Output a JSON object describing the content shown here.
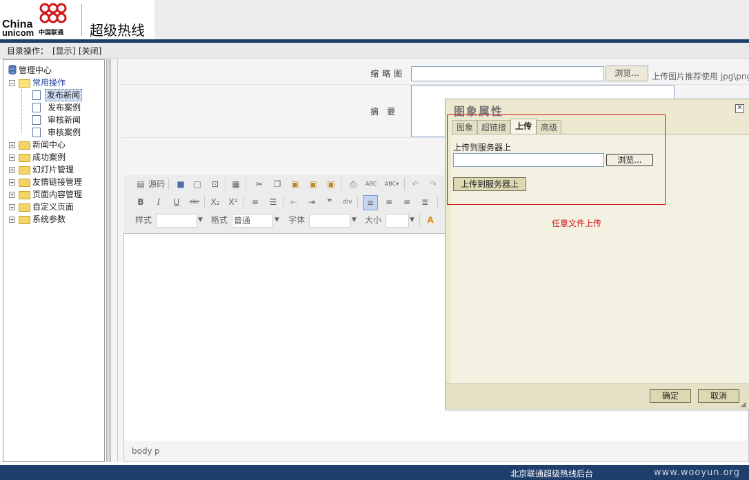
{
  "header": {
    "logo_line1": "China",
    "logo_line2": "unicom",
    "logo_cn": "中国联通",
    "title": "超级热线"
  },
  "menubar": {
    "label": "目录操作：",
    "show": "[显示]",
    "close": "[关闭]"
  },
  "tree": {
    "root": "管理中心",
    "common": "常用操作",
    "common_items": [
      "发布新闻",
      "发布案例",
      "审核新闻",
      "审核案例"
    ],
    "folders": [
      "新闻中心",
      "成功案例",
      "幻灯片管理",
      "友情链接管理",
      "页面内容管理",
      "自定义页面",
      "系统参数"
    ]
  },
  "form": {
    "thumb_label": "缩略图",
    "browse": "浏览...",
    "thumb_hint": "上传图片推荐使用 jpg\\png",
    "summary_label": "摘要"
  },
  "toolbar": {
    "source": "源码",
    "style_label": "样式",
    "format_label": "格式",
    "format_value": "普通",
    "font_label": "字体",
    "size_label": "大小"
  },
  "pathbar": {
    "body": "body",
    "p": "p"
  },
  "dialog": {
    "title": "图象属性",
    "tabs": [
      "图象",
      "超链接",
      "上传",
      "高级"
    ],
    "active_tab": "上传",
    "upload_label": "上传到服务器上",
    "browse": "浏览...",
    "upload_button": "上传到服务器上",
    "annotation": "任意文件上传",
    "ok": "确定",
    "cancel": "取消"
  },
  "footer": {
    "text": "北京联通超级热线后台",
    "watermark": "www.wooyun.org"
  },
  "colors": {
    "header_bar": "#1f3f6b",
    "annotation_red": "#d21515",
    "dialog_bg": "#ece9d0"
  }
}
